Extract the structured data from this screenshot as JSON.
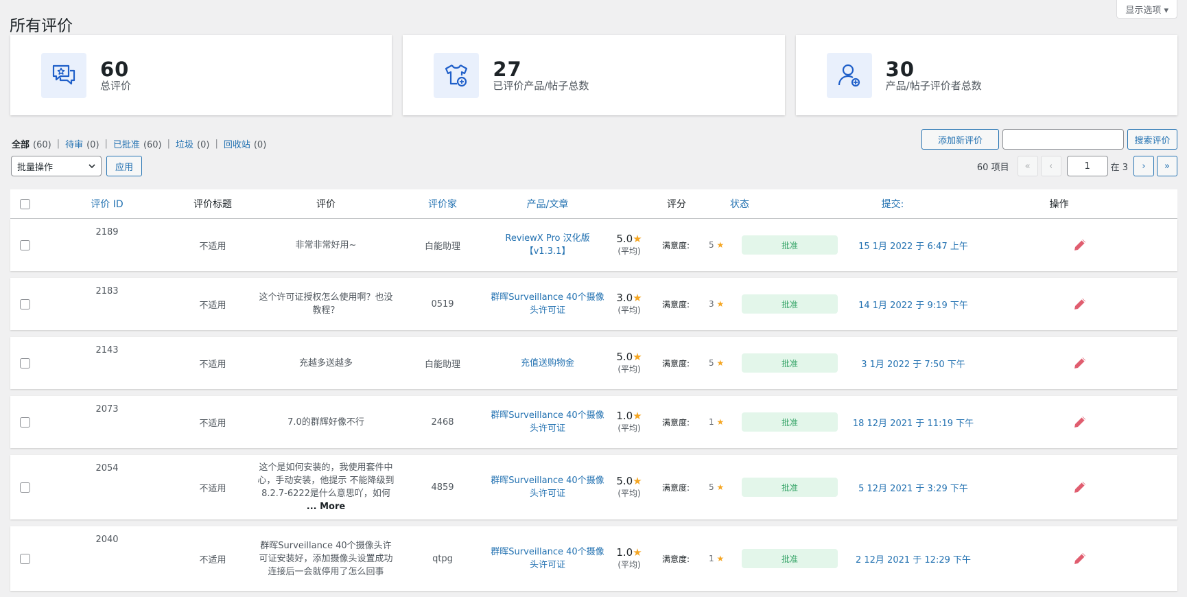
{
  "screen_options": "显示选项 ▾",
  "page_title": "所有评价",
  "stats": [
    {
      "icon": "review-chat-icon",
      "value": "60",
      "label": "总评价"
    },
    {
      "icon": "product-shirt-icon",
      "value": "27",
      "label": "已评价产品/帖子总数"
    },
    {
      "icon": "reviewer-user-icon",
      "value": "30",
      "label": "产品/帖子评价者总数"
    }
  ],
  "filters": [
    {
      "label": "全部",
      "count": "(60)",
      "current": true
    },
    {
      "label": "待审",
      "count": "(0)"
    },
    {
      "label": "已批准",
      "count": "(60)"
    },
    {
      "label": "垃圾",
      "count": "(0)"
    },
    {
      "label": "回收站",
      "count": "(0)"
    }
  ],
  "actions": {
    "add_new": "添加新评价",
    "search": "搜索评价",
    "search_value": ""
  },
  "bulk": {
    "selected": "批量操作",
    "apply": "应用"
  },
  "pagination": {
    "items": "60 项目",
    "first": "«",
    "prev": "‹",
    "current": "1",
    "of": "在 3",
    "next": "›",
    "last": "»"
  },
  "columns": {
    "id": "评价 ID",
    "title": "评价标题",
    "review": "评价",
    "reviewer": "评价家",
    "product": "产品/文章",
    "rating": "评分",
    "status": "状态",
    "date": "提交:",
    "action": "操作"
  },
  "rows": [
    {
      "id": "2189",
      "title": "不适用",
      "review": "非常非常好用~",
      "more": "",
      "reviewer": "白能助理",
      "product": "ReviewX Pro 汉化版【v1.3.1】",
      "rating": "5.0",
      "avg": "(平均)",
      "criteria": "满意度:",
      "criteria_value": "5",
      "status": "批准",
      "date": "15 1月 2022 于 6:47 上午"
    },
    {
      "id": "2183",
      "title": "不适用",
      "review": "这个许可证授权怎么使用啊？也没教程？",
      "more": "",
      "reviewer": "0519",
      "product": "群晖Surveillance 40个摄像头许可证",
      "rating": "3.0",
      "avg": "(平均)",
      "criteria": "满意度:",
      "criteria_value": "3",
      "status": "批准",
      "date": "14 1月 2022 于 9:19 下午"
    },
    {
      "id": "2143",
      "title": "不适用",
      "review": "充越多送越多",
      "more": "",
      "reviewer": "白能助理",
      "product": "充值送购物金",
      "rating": "5.0",
      "avg": "(平均)",
      "criteria": "满意度:",
      "criteria_value": "5",
      "status": "批准",
      "date": "3 1月 2022 于 7:50 下午"
    },
    {
      "id": "2073",
      "title": "不适用",
      "review": "7.0的群辉好像不行",
      "more": "",
      "reviewer": "2468",
      "product": "群晖Surveillance 40个摄像头许可证",
      "rating": "1.0",
      "avg": "(平均)",
      "criteria": "满意度:",
      "criteria_value": "1",
      "status": "批准",
      "date": "18 12月 2021 于 11:19 下午"
    },
    {
      "id": "2054",
      "title": "不适用",
      "review": "这个是如何安装的，我使用套件中心，手动安装，他提示 不能降级到8.2.7-6222是什么意思吖，如何",
      "more": "... More",
      "reviewer": "4859",
      "product": "群晖Surveillance 40个摄像头许可证",
      "rating": "5.0",
      "avg": "(平均)",
      "criteria": "满意度:",
      "criteria_value": "5",
      "status": "批准",
      "date": "5 12月 2021 于 3:29 下午"
    },
    {
      "id": "2040",
      "title": "不适用",
      "review": "群晖Surveillance 40个摄像头许可证安装好，添加摄像头设置成功连接后一会就停用了怎么回事",
      "more": "",
      "reviewer": "qtpg",
      "product": "群晖Surveillance 40个摄像头许可证",
      "rating": "1.0",
      "avg": "(平均)",
      "criteria": "满意度:",
      "criteria_value": "1",
      "status": "批准",
      "date": "2 12月 2021 于 12:29 下午"
    }
  ],
  "colors": {
    "accent": "#2271b1",
    "badge_bg": "#e3f6ea",
    "badge_text": "#3aa66b",
    "star": "#f5a623",
    "edit": "#e05d6f"
  }
}
